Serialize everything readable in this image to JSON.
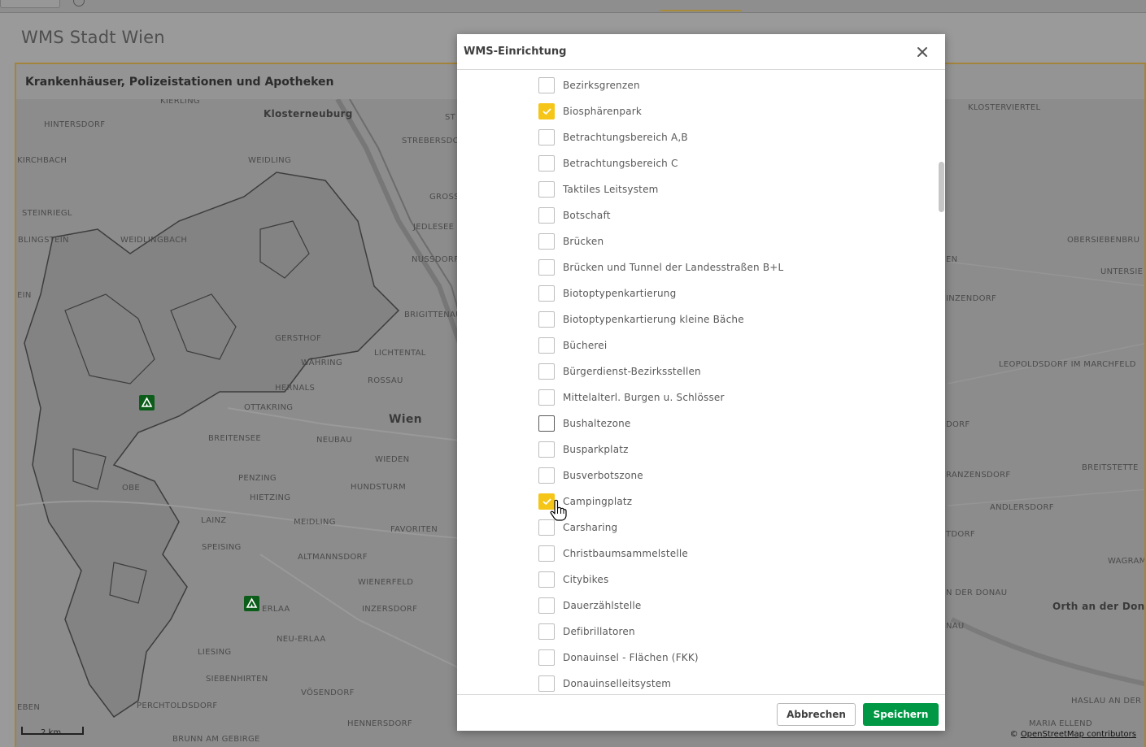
{
  "app": {
    "title": "WMS Stadt Wien"
  },
  "panel": {
    "title": "Krankenhäuser, Polizeistationen und Apotheken"
  },
  "map": {
    "labels": [
      {
        "id": "kierling",
        "text": "KIERLING",
        "style": "small"
      },
      {
        "id": "klosterneuburg",
        "text": "Klosterneuburg",
        "style": "mid"
      },
      {
        "id": "hintersdorf",
        "text": "HINTERSDORF",
        "style": "small"
      },
      {
        "id": "kirchbach",
        "text": "KIRCHBACH",
        "style": "small"
      },
      {
        "id": "weidling",
        "text": "WEIDLING",
        "style": "small"
      },
      {
        "id": "steinriegl",
        "text": "STEINRIEGL",
        "style": "small"
      },
      {
        "id": "blingstein",
        "text": "BLINGSTEIN",
        "style": "small"
      },
      {
        "id": "weidlingbach",
        "text": "WEIDLINGBACH",
        "style": "small"
      },
      {
        "id": "strebersdorf",
        "text": "STREBERSDO",
        "style": "small"
      },
      {
        "id": "gross",
        "text": "GROSS",
        "style": "small"
      },
      {
        "id": "jedlesee",
        "text": "JEDLESEE",
        "style": "small"
      },
      {
        "id": "nussdorf",
        "text": "NUSSDORF",
        "style": "small"
      },
      {
        "id": "st",
        "text": "ST",
        "style": "small"
      },
      {
        "id": "brigittenau",
        "text": "BRIGITTENAU",
        "style": "small"
      },
      {
        "id": "gersthof",
        "text": "GERSTHOF",
        "style": "small"
      },
      {
        "id": "waehring",
        "text": "WÄHRING",
        "style": "small"
      },
      {
        "id": "lichtental",
        "text": "LICHTENTAL",
        "style": "small"
      },
      {
        "id": "hernals",
        "text": "HERNALS",
        "style": "small"
      },
      {
        "id": "rossau",
        "text": "ROSSAU",
        "style": "small"
      },
      {
        "id": "ottakring",
        "text": "OTTAKRING",
        "style": "small"
      },
      {
        "id": "wien",
        "text": "Wien",
        "style": "big"
      },
      {
        "id": "breitensee",
        "text": "BREITENSEE",
        "style": "small"
      },
      {
        "id": "neubau",
        "text": "NEUBAU",
        "style": "small"
      },
      {
        "id": "wieden",
        "text": "WIEDEN",
        "style": "small"
      },
      {
        "id": "penzing",
        "text": "PENZING",
        "style": "small"
      },
      {
        "id": "hundsturm",
        "text": "HUNDSTURM",
        "style": "small"
      },
      {
        "id": "hietzing",
        "text": "HIETZING",
        "style": "small"
      },
      {
        "id": "meidling",
        "text": "MEIDLING",
        "style": "small"
      },
      {
        "id": "favoriten",
        "text": "FAVORITEN",
        "style": "small"
      },
      {
        "id": "lainz",
        "text": "LAINZ",
        "style": "small"
      },
      {
        "id": "speising",
        "text": "SPEISING",
        "style": "small"
      },
      {
        "id": "altmannsdorf",
        "text": "ALTMANNSDORF",
        "style": "small"
      },
      {
        "id": "wienerfeld",
        "text": "WIENERFELD",
        "style": "small"
      },
      {
        "id": "inzersdorf",
        "text": "INZERSDORF",
        "style": "small"
      },
      {
        "id": "erlaa",
        "text": "ERLAA",
        "style": "small"
      },
      {
        "id": "neuerlaa",
        "text": "NEU-ERLAA",
        "style": "small"
      },
      {
        "id": "liesing",
        "text": "LIESING",
        "style": "small"
      },
      {
        "id": "siebenhirten",
        "text": "SIEBENHIRTEN",
        "style": "small"
      },
      {
        "id": "vosendorf",
        "text": "VÖSENDORF",
        "style": "small"
      },
      {
        "id": "perchtoldsdorf",
        "text": "PERCHTOLDSDORF",
        "style": "small"
      },
      {
        "id": "hennersdorf",
        "text": "HENNERSDORF",
        "style": "small"
      },
      {
        "id": "brunn",
        "text": "BRUNN AM GEBIRGE",
        "style": "small"
      },
      {
        "id": "eben",
        "text": "EBEN",
        "style": "small"
      },
      {
        "id": "klosterviertel",
        "text": "KLOSTERVIERTEL",
        "style": "small"
      },
      {
        "id": "obersiebenbrunn",
        "text": "OBERSIEBENBRU",
        "style": "small"
      },
      {
        "id": "untersie",
        "text": "UNTERSIE",
        "style": "small"
      },
      {
        "id": "inzendorf",
        "text": "INZENDORF",
        "style": "small"
      },
      {
        "id": "leopoldsdorf",
        "text": "LEOPOLDSDORF IM MARCHFELD",
        "style": "small"
      },
      {
        "id": "en",
        "text": "EN",
        "style": "small"
      },
      {
        "id": "dorf",
        "text": "DORF",
        "style": "small"
      },
      {
        "id": "franzensdorf",
        "text": "RANZENSDORF",
        "style": "small"
      },
      {
        "id": "breitstetten",
        "text": "BREITSTETTE",
        "style": "small"
      },
      {
        "id": "andlersdorf",
        "text": "ANDLERSDORF",
        "style": "small"
      },
      {
        "id": "tdorf",
        "text": "TDORF",
        "style": "small"
      },
      {
        "id": "wagram",
        "text": "WAGRAM A",
        "style": "small"
      },
      {
        "id": "derdonau",
        "text": "N DER DONAU",
        "style": "small"
      },
      {
        "id": "orth",
        "text": "Orth an der Donau",
        "style": "mid"
      },
      {
        "id": "nau",
        "text": "NAU",
        "style": "small"
      },
      {
        "id": "hasslau",
        "text": "HASLAU AN DER",
        "style": "small"
      },
      {
        "id": "mariaellend",
        "text": "MARIA ELLEND",
        "style": "small"
      },
      {
        "id": "ein",
        "text": "EIN",
        "style": "small"
      },
      {
        "id": "obe",
        "text": "OBE",
        "style": "small"
      }
    ],
    "scale_label": "2 km",
    "attribution_prefix": "© ",
    "attribution_link": "OpenStreetMap contributors",
    "marker_icon": "campsite-icon",
    "marker_color": "#0c5d1a"
  },
  "dialog": {
    "title": "WMS-Einrichtung",
    "close_icon": "close-icon",
    "layers": [
      {
        "label": "Bezirksgrenzen",
        "checked": false
      },
      {
        "label": "Biosphärenpark",
        "checked": true
      },
      {
        "label": "Betrachtungsbereich A,B",
        "checked": false
      },
      {
        "label": "Betrachtungsbereich C",
        "checked": false
      },
      {
        "label": "Taktiles Leitsystem",
        "checked": false
      },
      {
        "label": "Botschaft",
        "checked": false
      },
      {
        "label": "Brücken",
        "checked": false
      },
      {
        "label": "Brücken und Tunnel der Landesstraßen B+L",
        "checked": false
      },
      {
        "label": "Biotoptypenkartierung",
        "checked": false
      },
      {
        "label": "Biotoptypenkartierung kleine Bäche",
        "checked": false
      },
      {
        "label": "Bücherei",
        "checked": false
      },
      {
        "label": "Bürgerdienst-Bezirksstellen",
        "checked": false
      },
      {
        "label": "Mittelalterl. Burgen u. Schlösser",
        "checked": false
      },
      {
        "label": "Bushaltezone",
        "checked": false
      },
      {
        "label": "Busparkplatz",
        "checked": false
      },
      {
        "label": "Busverbotszone",
        "checked": false
      },
      {
        "label": "Campingplatz",
        "checked": true
      },
      {
        "label": "Carsharing",
        "checked": false
      },
      {
        "label": "Christbaumsammelstelle",
        "checked": false
      },
      {
        "label": "Citybikes",
        "checked": false
      },
      {
        "label": "Dauerzählstelle",
        "checked": false
      },
      {
        "label": "Defibrillatoren",
        "checked": false
      },
      {
        "label": "Donauinsel - Flächen (FKK)",
        "checked": false
      },
      {
        "label": "Donauinselleitsystem",
        "checked": false
      }
    ],
    "cancel_label": "Abbrechen",
    "save_label": "Speichern",
    "accent_color": "#f5c518",
    "save_color": "#009845"
  }
}
